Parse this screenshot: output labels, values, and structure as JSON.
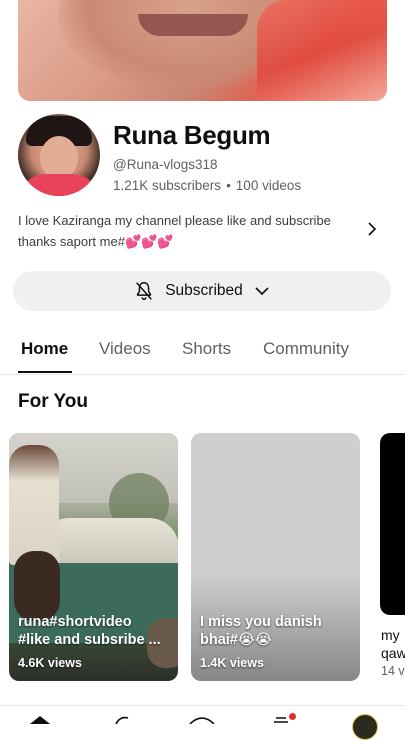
{
  "channel": {
    "name": "Runa Begum",
    "handle": "@Runa-vlogs318",
    "subscribers": "1.21K subscribers",
    "separator": "•",
    "videos": "100 videos",
    "description_line1": "I love Kaziranga  my channel please like and subscribe",
    "description_line2": "thanks saport me#💕💕💕"
  },
  "subscribe_button": {
    "label": "Subscribed",
    "icon": "bell-off-icon",
    "chevron": "chevron-down-icon"
  },
  "tabs": [
    "Home",
    "Videos",
    "Shorts",
    "Community"
  ],
  "section": {
    "title": "For You"
  },
  "shorts": [
    {
      "title_line1": "runa#shortvideo",
      "title_line2": "#like and subsribe ...",
      "views": "4.6K views"
    },
    {
      "title_line1": "I miss you danish",
      "title_line2": "bhai#😭😭",
      "views": "1.4K views"
    },
    {
      "title_line1": "my",
      "title_line2": "qaw",
      "views": "14 v"
    }
  ],
  "bottom_nav": [
    "home-icon",
    "shorts-icon",
    "create-icon",
    "subscriptions-icon",
    "you-avatar"
  ],
  "colors": {
    "text_primary": "#0f0f0f",
    "text_secondary": "#606060",
    "button_bg": "#f0f0f0",
    "notification_dot": "#e32f25"
  }
}
